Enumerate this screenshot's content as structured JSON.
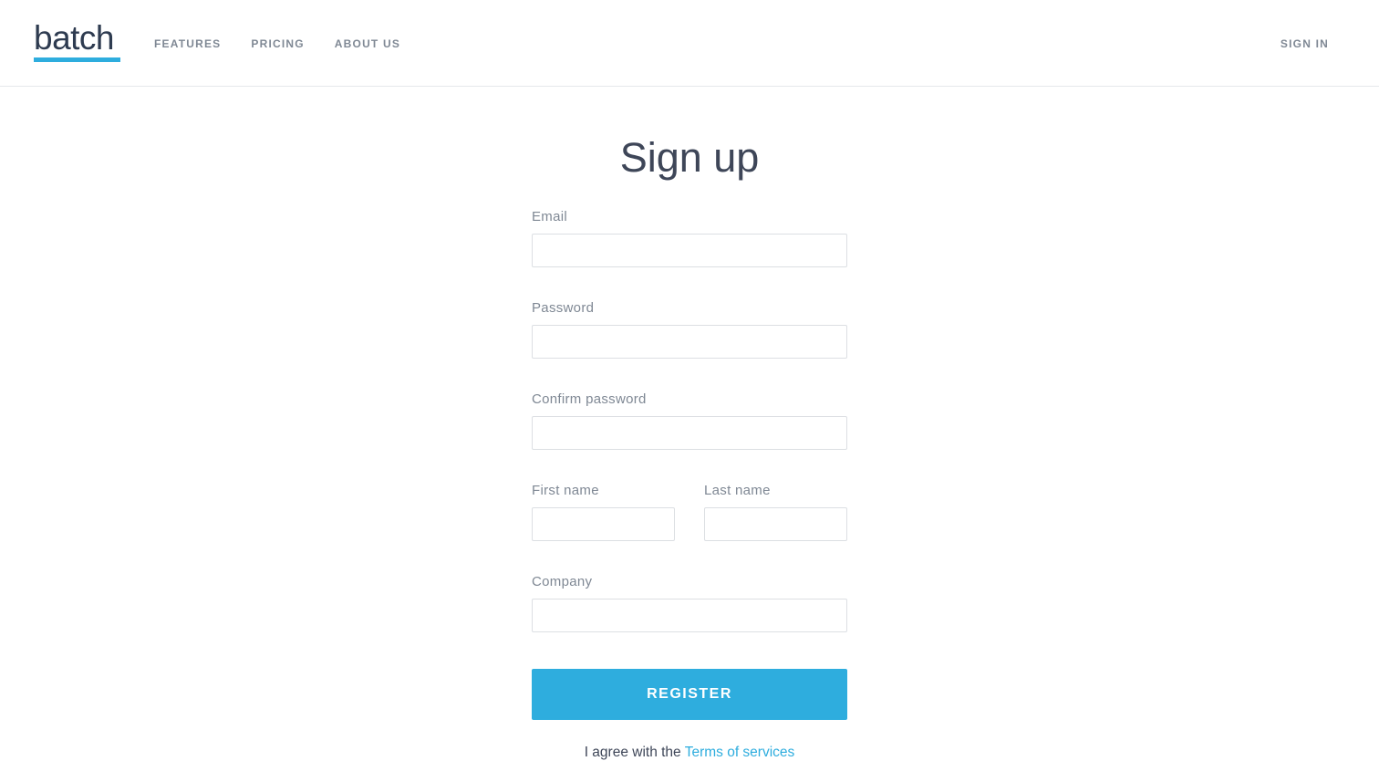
{
  "header": {
    "logo_text": "batch",
    "nav": [
      {
        "label": "FEATURES"
      },
      {
        "label": "PRICING"
      },
      {
        "label": "ABOUT US"
      }
    ],
    "signin_label": "SIGN IN"
  },
  "form": {
    "title": "Sign up",
    "email": {
      "label": "Email",
      "value": ""
    },
    "password": {
      "label": "Password",
      "value": ""
    },
    "confirm_password": {
      "label": "Confirm password",
      "value": ""
    },
    "first_name": {
      "label": "First name",
      "value": ""
    },
    "last_name": {
      "label": "Last name",
      "value": ""
    },
    "company": {
      "label": "Company",
      "value": ""
    },
    "register_label": "REGISTER",
    "terms_prefix": "I agree with the ",
    "terms_link": "Terms of services"
  },
  "colors": {
    "accent": "#2eadde",
    "text_dark": "#3e4658",
    "text_muted": "#7f8894",
    "logo": "#2e3b50",
    "border": "#dcdfe3"
  }
}
